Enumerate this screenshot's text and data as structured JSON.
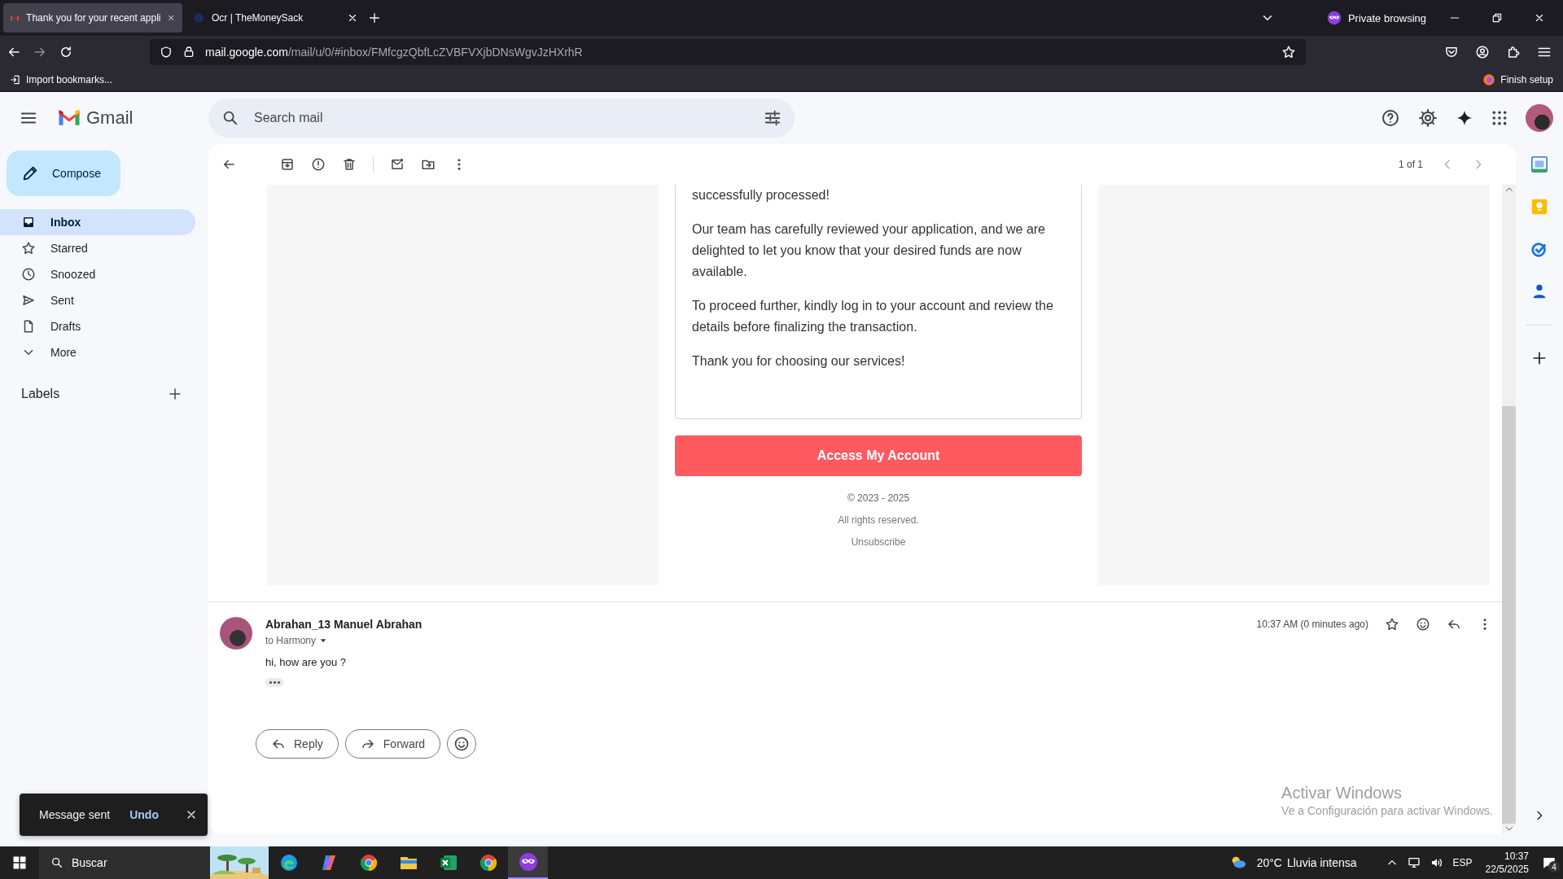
{
  "browser": {
    "tabs": [
      {
        "title": "Thank you for your recent appli",
        "kind": "gmail",
        "selected": true
      },
      {
        "title": "Ocr | TheMoneySack",
        "kind": "site",
        "selected": false
      }
    ],
    "private_label": "Private browsing",
    "url": {
      "host": "mail.google.com",
      "path": "/mail/u/0/#inbox/FMfcgzQbfLcZVBFVXjbDNsWgvJzHXrhR"
    },
    "bookmark": "Import bookmarks...",
    "finish_setup": "Finish setup"
  },
  "gmail": {
    "logo": "Gmail",
    "search": {
      "placeholder": "Search mail"
    },
    "compose": "Compose",
    "nav": [
      {
        "label": "Inbox",
        "kind": "inbox",
        "selected": true
      },
      {
        "label": "Starred",
        "kind": "star",
        "selected": false
      },
      {
        "label": "Snoozed",
        "kind": "clock",
        "selected": false
      },
      {
        "label": "Sent",
        "kind": "send",
        "selected": false
      },
      {
        "label": "Drafts",
        "kind": "file",
        "selected": false
      },
      {
        "label": "More",
        "kind": "more",
        "selected": false
      }
    ],
    "labels_heading": "Labels",
    "pager": "1 of 1"
  },
  "email": {
    "paragraphs": [
      "successfully processed!",
      "Our team has carefully reviewed your application, and we are delighted to let you know that your desired funds are now available.",
      "To proceed further, kindly log in to your account and review the details before finalizing the transaction.",
      "Thank you for choosing our services!"
    ],
    "cta": "Access My Account",
    "footer": [
      "© 2023 - 2025",
      "All rights reserved.",
      "Unsubscribe"
    ]
  },
  "message": {
    "sender": "Abrahan_13 Manuel Abrahan",
    "to": "to Harmony",
    "time": "10:37 AM (0 minutes ago)",
    "body": "hi, how are you ?"
  },
  "actions": [
    "Reply",
    "Forward"
  ],
  "toast": {
    "text": "Message sent",
    "action": "Undo"
  },
  "activation": {
    "title": "Activar Windows",
    "subtitle": "Ve a Configuración para activar Windows."
  },
  "taskbar": {
    "search_placeholder": "Buscar",
    "apps": [
      {
        "kind": "edge",
        "selected": false
      },
      {
        "kind": "copilot",
        "selected": false
      },
      {
        "kind": "chrome",
        "selected": false
      },
      {
        "kind": "files",
        "selected": false
      },
      {
        "kind": "excel",
        "selected": false
      },
      {
        "kind": "chrome",
        "selected": false
      },
      {
        "kind": "private",
        "selected": true
      }
    ],
    "temperature": "20°C",
    "weather": "Lluvia intensa",
    "language": "ESP",
    "time": "10:37",
    "date": "22/5/2025",
    "notifications": "4"
  }
}
